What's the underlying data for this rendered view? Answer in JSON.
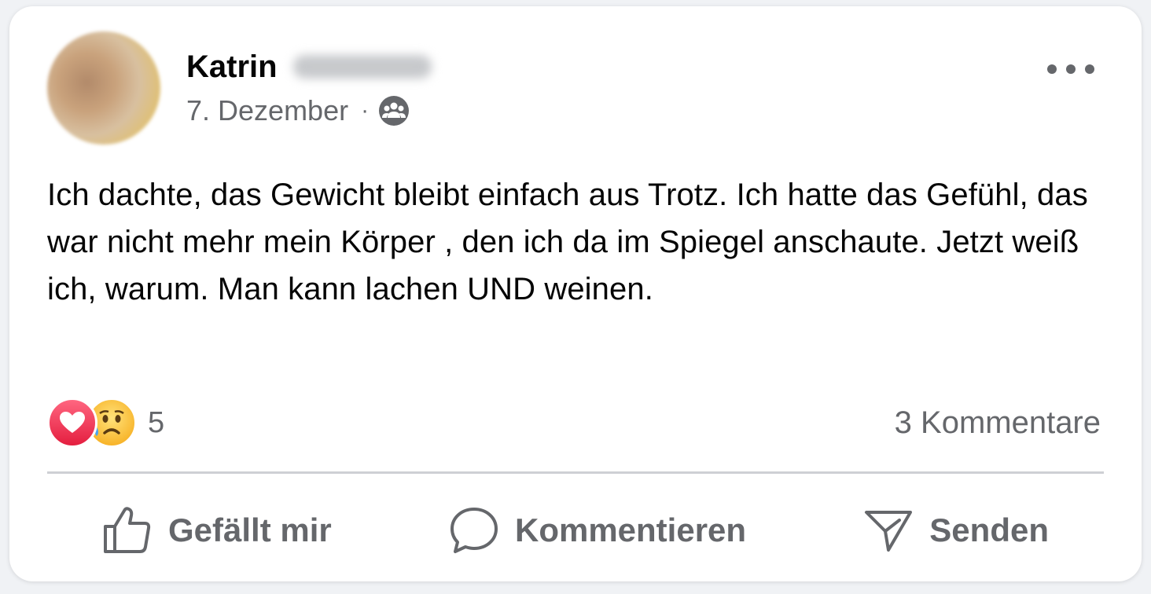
{
  "post": {
    "author_first_name": "Katrin",
    "date": "7. Dezember",
    "meta_separator": "·",
    "audience_icon": "group-icon",
    "text": "Ich dachte, das Gewicht bleibt einfach aus Trotz. Ich hatte das Gefühl, das war nicht mehr mein Körper , den ich da im Spiegel anschaute. Jetzt weiß ich, warum. Man kann lachen UND weinen.",
    "reactions": {
      "types": [
        "love-icon",
        "sad-icon"
      ],
      "count": "5"
    },
    "comments_label": "3 Kommentare"
  },
  "actions": {
    "like_label": "Gefällt mir",
    "comment_label": "Kommentieren",
    "send_label": "Senden"
  },
  "colors": {
    "primary_text": "#050505",
    "secondary_text": "#65676b",
    "love_red": "#e41e3f",
    "sad_yellow": "#f7b125",
    "divider": "#ced0d4"
  }
}
